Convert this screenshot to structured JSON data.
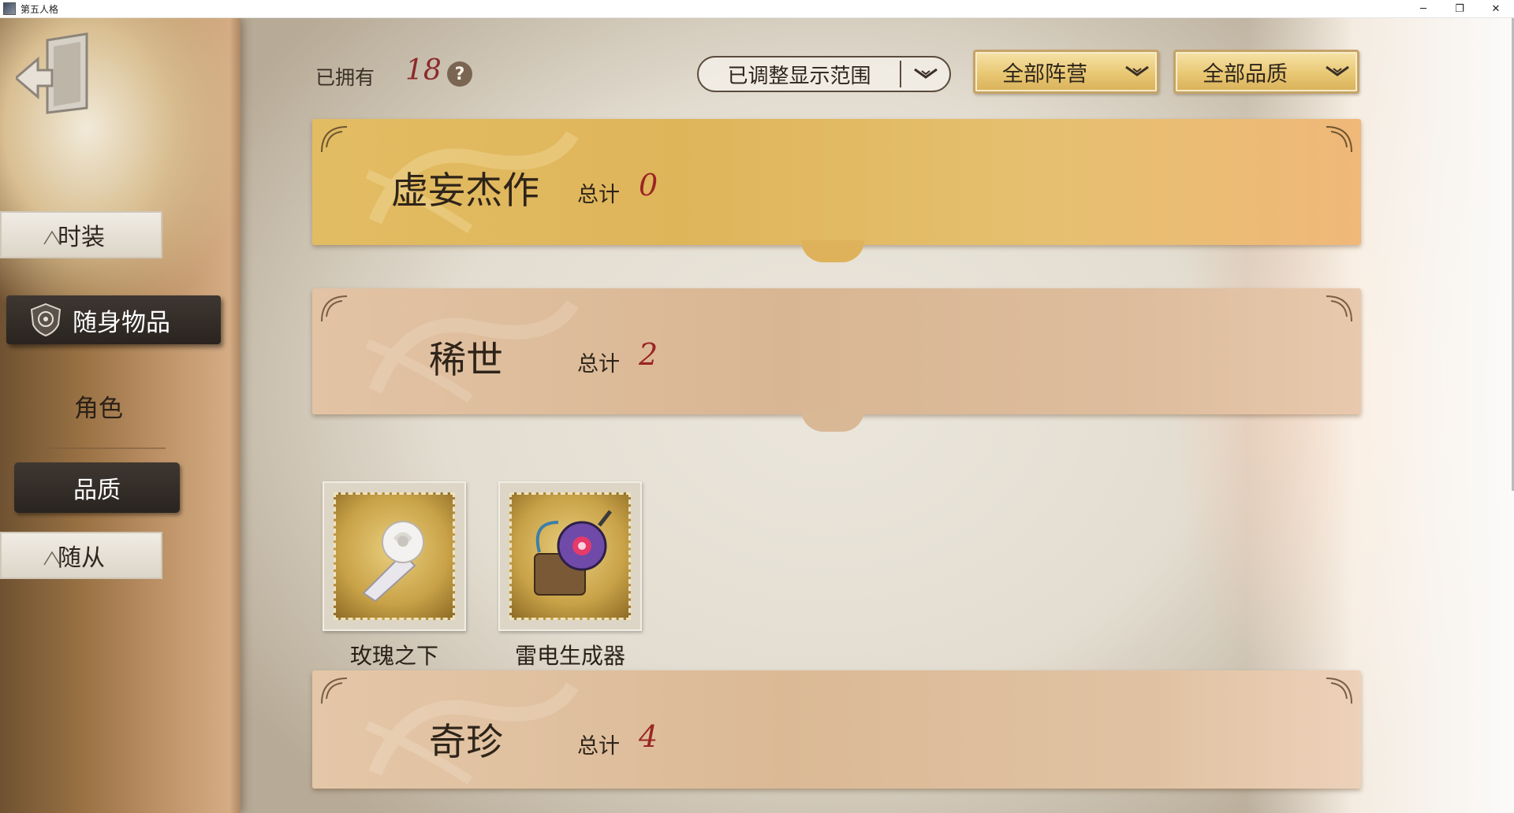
{
  "window": {
    "title": "第五人格",
    "controls": {
      "minimize": "─",
      "restore": "❐",
      "close": "✕"
    }
  },
  "sidebar": {
    "items": [
      {
        "label": "时装",
        "active": false
      },
      {
        "label": "随身物品",
        "active": true,
        "icon": "emblem-icon"
      },
      {
        "label": "角色",
        "active": false
      },
      {
        "label": "品质",
        "active": true
      },
      {
        "label": "随从",
        "active": false
      }
    ]
  },
  "header": {
    "owned_label": "已拥有",
    "owned_count": "18",
    "help": "?",
    "range_filter": "已调整显示范围",
    "camp_filter": "全部阵营",
    "quality_filter": "全部品质"
  },
  "tiers": [
    {
      "name": "虚妄杰作",
      "total_label": "总计",
      "total": "0"
    },
    {
      "name": "稀世",
      "total_label": "总计",
      "total": "2"
    },
    {
      "name": "奇珍",
      "total_label": "总计",
      "total": "4"
    }
  ],
  "items": [
    {
      "name": "玫瑰之下",
      "icon": "rose-bouquet-icon"
    },
    {
      "name": "雷电生成器",
      "icon": "lightning-generator-icon"
    }
  ],
  "colors": {
    "accent_red": "#9b2525",
    "gold_banner": "#e2bc63",
    "tan_banner": "#d9b693",
    "dark_tab": "#2a2420"
  }
}
